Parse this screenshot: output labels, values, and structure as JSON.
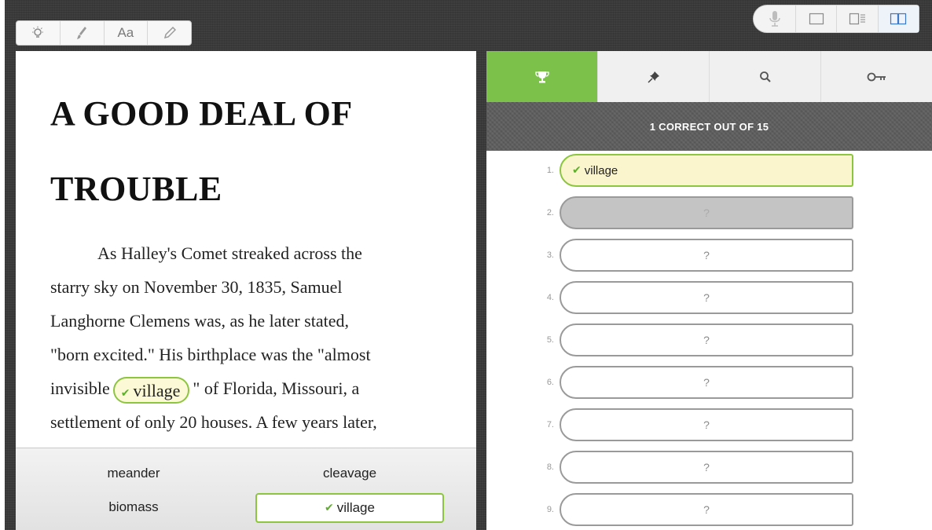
{
  "toolbar": {
    "items": [
      {
        "icon": "lightbulb-icon",
        "glyph": "☀"
      },
      {
        "icon": "brush-icon",
        "glyph": "✎"
      },
      {
        "icon": "font-size-icon",
        "label": "Aa"
      },
      {
        "icon": "pencil-icon",
        "glyph": "✏"
      }
    ]
  },
  "view_controls": {
    "icons": [
      "microphone-icon",
      "single-page-icon",
      "page-with-sidebar-icon",
      "two-page-icon"
    ],
    "active": "two-page-icon"
  },
  "book": {
    "title_line1": "A GOOD DEAL OF",
    "title_line2": "TROUBLE",
    "lines": [
      "As Halley's Comet streaked across the",
      "starry sky on November 30, 1835, Samuel",
      "Langhorne Clemens was, as he later stated,",
      "\"born excited.\" His birthplace was the \"almost",
      "settlement of only 20 houses. A few years later,"
    ],
    "line5_before": "invisible",
    "line5_answer": "village",
    "line5_after": "\" of Florida, Missouri, a"
  },
  "word_bank": {
    "words": [
      "meander",
      "cleavage",
      "biomass"
    ],
    "selected": "village"
  },
  "panel": {
    "tabs": [
      {
        "icon": "trophy-icon",
        "active": true
      },
      {
        "icon": "pin-icon",
        "active": false
      },
      {
        "icon": "search-icon",
        "active": false
      },
      {
        "icon": "key-icon",
        "active": false
      }
    ],
    "score_text": "1 CORRECT OUT OF 15",
    "answers": [
      {
        "num": "1.",
        "text": "village",
        "state": "correct"
      },
      {
        "num": "2.",
        "text": "?",
        "state": "current"
      },
      {
        "num": "3.",
        "text": "?",
        "state": "empty"
      },
      {
        "num": "4.",
        "text": "?",
        "state": "empty"
      },
      {
        "num": "5.",
        "text": "?",
        "state": "empty"
      },
      {
        "num": "6.",
        "text": "?",
        "state": "empty"
      },
      {
        "num": "7.",
        "text": "?",
        "state": "empty"
      },
      {
        "num": "8.",
        "text": "?",
        "state": "empty"
      },
      {
        "num": "9.",
        "text": "?",
        "state": "empty"
      }
    ]
  },
  "colors": {
    "accent_green": "#7cc24a",
    "correct_fill": "#faf5cc",
    "frame_dark": "#3a3a3a"
  }
}
